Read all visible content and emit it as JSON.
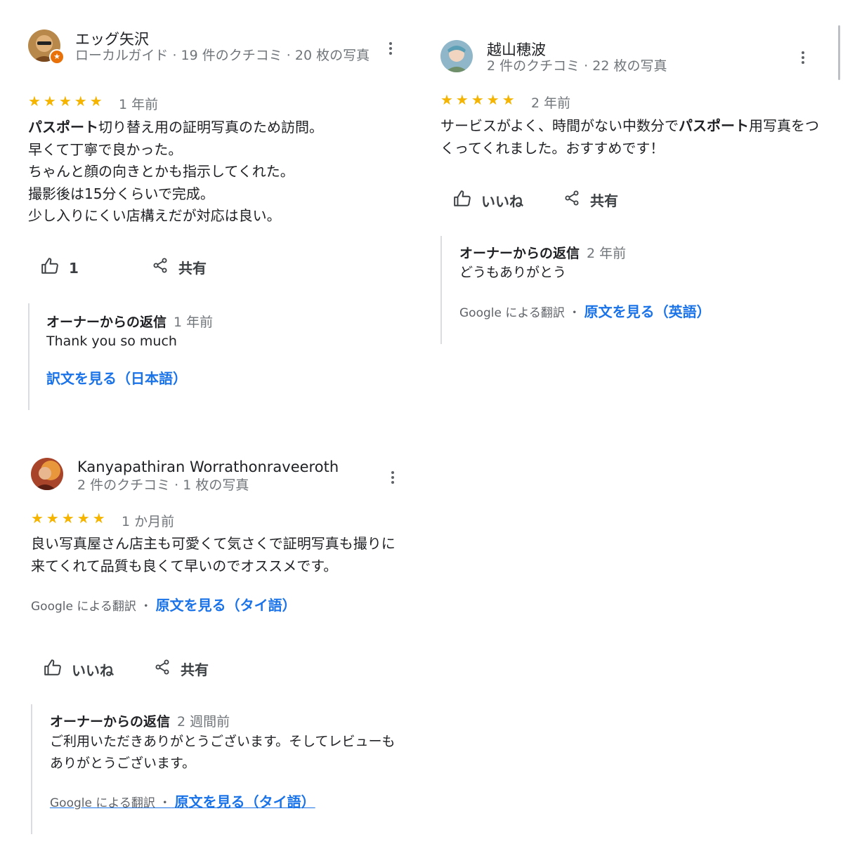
{
  "reviews": [
    {
      "name": "エッグ矢沢",
      "meta": "ローカルガイド · 19 件のクチコミ · 20 枚の写真",
      "stars": "★★★★★",
      "ago": "1 年前",
      "body": {
        "l1_bold": "パスポート",
        "l1_rest": "切り替え用の証明写真のため訪問。",
        "l2": "早くて丁寧で良かった。",
        "l3": "ちゃんと顔の向きとかも指示してくれた。",
        "l4": "撮影後は15分くらいで完成。",
        "l5": "少し入りにくい店構えだが対応は良い。"
      },
      "like_label": "1",
      "share_label": "共有",
      "reply": {
        "title": "オーナーからの返信",
        "ago": "1 年前",
        "text": "Thank you so much",
        "link": "訳文を見る（日本語）"
      }
    },
    {
      "name": "越山穂波",
      "meta": "2 件のクチコミ · 22 枚の写真",
      "stars": "★★★★★",
      "ago": "2 年前",
      "body": {
        "p1": "サービスがよく、時間がない中数分で",
        "bold": "パスポート",
        "p2": "用写真をつくってくれました。おすすめです！"
      },
      "like_label": "いいね",
      "share_label": "共有",
      "reply": {
        "title": "オーナーからの返信",
        "ago": "2 年前",
        "text": "どうもありがとう",
        "xlate_prefix": "Google による翻訳 ・",
        "link": "原文を見る（英語）"
      }
    },
    {
      "name": "Kanyapathiran Worrathonraveeroth",
      "meta": "2 件のクチコミ · 1 枚の写真",
      "stars": "★★★★★",
      "ago": "1 か月前",
      "body": "良い写真屋さん店主も可愛くて気さくで証明写真も撮りに来てくれて品質も良くて早いのでオススメです。",
      "xlate_prefix": "Google による翻訳 ・",
      "xlate_link": "原文を見る（タイ語）",
      "like_label": "いいね",
      "share_label": "共有",
      "reply": {
        "title": "オーナーからの返信",
        "ago": "2 週間前",
        "text": "ご利用いただきありがとうございます。そしてレビューもありがとうございます。",
        "xlate_prefix": "Google による翻訳 ・",
        "link": "原文を見る（タイ語）"
      }
    }
  ],
  "colors": {
    "star": "#f4b400",
    "link": "#1a73e8",
    "muted": "#70757a"
  },
  "icons": [
    "thumbs-up-icon",
    "share-icon",
    "more-vert-icon",
    "avatar"
  ]
}
